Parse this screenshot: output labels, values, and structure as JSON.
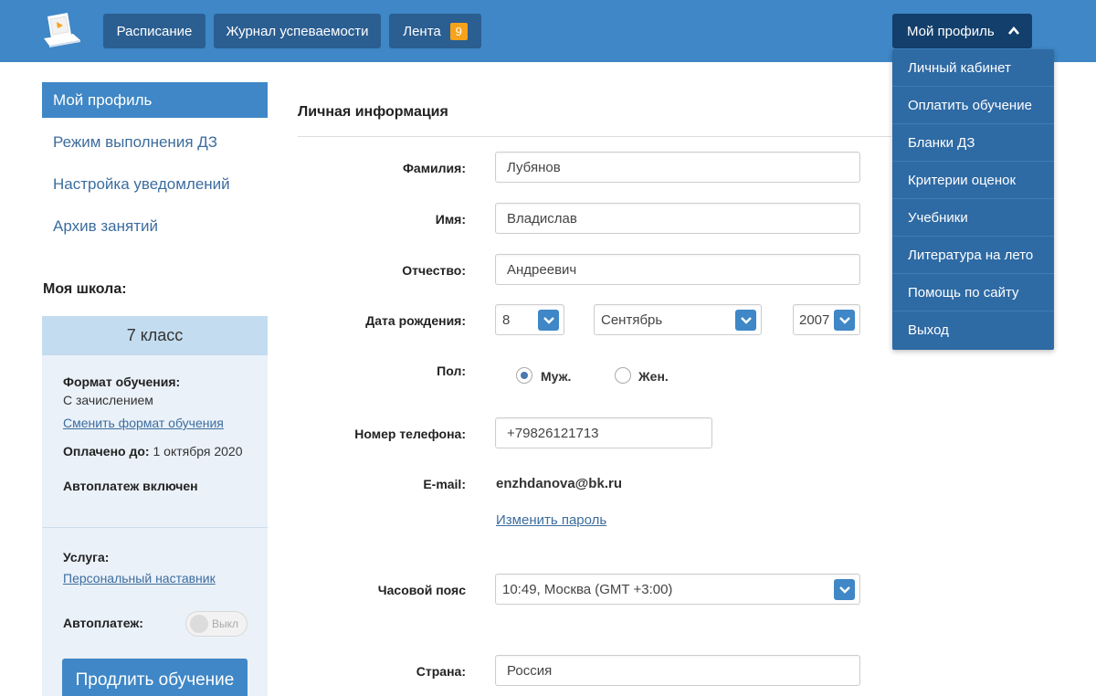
{
  "topbar": {
    "nav": [
      {
        "label": "Расписание"
      },
      {
        "label": "Журнал успеваемости"
      },
      {
        "label": "Лента",
        "badge": "9"
      }
    ],
    "profile_label": "Мой профиль"
  },
  "dropdown": {
    "items": [
      {
        "label": "Личный кабинет"
      },
      {
        "label": "Оплатить обучение"
      },
      {
        "label": "Бланки ДЗ"
      },
      {
        "label": "Критерии оценок"
      },
      {
        "label": "Учебники"
      },
      {
        "label": "Литература на лето"
      },
      {
        "label": "Помощь по сайту"
      },
      {
        "label": "Выход"
      }
    ]
  },
  "sidebar": {
    "items": [
      {
        "label": "Мой профиль"
      },
      {
        "label": "Режим выполнения ДЗ"
      },
      {
        "label": "Настройка уведомлений"
      },
      {
        "label": "Архив занятий"
      }
    ],
    "school_title": "Моя школа:",
    "card": {
      "class_name": "7 класс",
      "format_label": "Формат обучения:",
      "format_value": "С зачислением",
      "change_format_link": "Сменить формат обучения",
      "paid_label": "Оплачено до:",
      "paid_value": "1 октября 2020",
      "autopay_status": "Автоплатеж включен",
      "service_label": "Услуга:",
      "service_value": "Персональный наставник",
      "autopay_label": "Автоплатеж:",
      "toggle_text": "Выкл",
      "extend_button": "Продлить обучение"
    }
  },
  "form": {
    "section_title": "Личная информация",
    "surname_label": "Фамилия:",
    "surname_value": "Лубянов",
    "name_label": "Имя:",
    "name_value": "Владислав",
    "patronymic_label": "Отчество:",
    "patronymic_value": "Андреевич",
    "birth_label": "Дата рождения:",
    "birth_day": "8",
    "birth_month": "Сентябрь",
    "birth_year": "2007",
    "gender_label": "Пол:",
    "gender_male": "Муж.",
    "gender_female": "Жен.",
    "phone_label": "Номер телефона:",
    "phone_value": "+79826121713",
    "email_label": "E-mail:",
    "email_value": "enzhdanova@bk.ru",
    "change_password_link": "Изменить пароль",
    "timezone_label": "Часовой пояс",
    "timezone_value": "10:49, Москва (GMT +3:00)",
    "country_label": "Страна:",
    "country_value": "Россия"
  },
  "colors": {
    "topbar": "#3f87c6",
    "nav_button": "#2b5e91",
    "profile_button": "#133f6c",
    "dropdown": "#2e6aa4",
    "badge": "#f7a21b",
    "link": "#3c6d9e",
    "card": "#eaf1f9"
  },
  "icons": {
    "logo": "laptop-logo-icon",
    "profile_chevron": "chevron-up-icon",
    "select_arrow": "chevron-down-icon"
  }
}
